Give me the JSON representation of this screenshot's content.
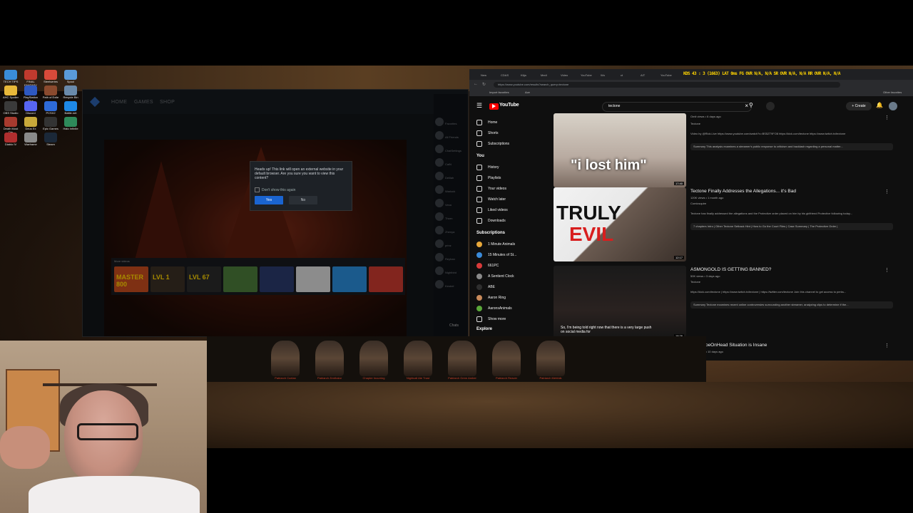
{
  "desktop": {
    "icons": [
      {
        "label": "TECH TIPS",
        "color": "#3a8cd8"
      },
      {
        "label": "FINAL FANTASY XI...",
        "color": "#c03a2e"
      },
      {
        "label": "Steelseries",
        "color": "#d84a3a"
      },
      {
        "label": "Spool",
        "color": "#5a9ad8"
      },
      {
        "label": "AHC Spoiler",
        "color": "#e8b83a"
      },
      {
        "label": "PlayStation Plus",
        "color": "#2e58c0"
      },
      {
        "label": "Path of Exile",
        "color": "#8a4a2e"
      },
      {
        "label": "Recycle Bin",
        "color": "#6a8aaa"
      },
      {
        "label": "OBS Studio",
        "color": "#3a3a3a"
      },
      {
        "label": "Discord",
        "color": "#5865f2"
      },
      {
        "label": "PCSX2",
        "color": "#2e6ad8"
      },
      {
        "label": "Battle.net",
        "color": "#1e88e5"
      },
      {
        "label": "Death Must Die",
        "color": "#a83a2e"
      },
      {
        "label": "Deus Ex",
        "color": "#c8a83a"
      },
      {
        "label": "Epic Games",
        "color": "#333333"
      },
      {
        "label": "Halo Infinite",
        "color": "#2e8a5a"
      },
      {
        "label": "Diablo IV",
        "color": "#b02e2e"
      },
      {
        "label": "Warframe",
        "color": "#8a8a8a"
      },
      {
        "label": "Steam",
        "color": "#1b2838"
      }
    ]
  },
  "launcher": {
    "nav": [
      "HOME",
      "GAMES",
      "SHOP"
    ],
    "dialog": {
      "message": "Heads up! This link will open an external website in your default browser. Are you sure you want to view this content?",
      "checkbox": "Don't show this again",
      "yes": "Yes",
      "no": "No"
    },
    "more_videos_label": "More videos",
    "thumbs": [
      {
        "text": "MASTER 800",
        "color": "#c24a1e"
      },
      {
        "text": "LVL 1",
        "color": "#3a2e24"
      },
      {
        "text": "LVL 67",
        "color": "#2a2a2a"
      },
      {
        "text": "",
        "color": "#4a7a3a"
      },
      {
        "text": "",
        "color": "#2a3a6a"
      },
      {
        "text": "",
        "color": "#d8d8d8"
      },
      {
        "text": "",
        "color": "#2a8ad8"
      },
      {
        "text": "",
        "color": "#c83a2e"
      }
    ],
    "friends": [
      "Favorites",
      "All Friends",
      "ChatSettings",
      "CaiN",
      "Delilah",
      "Warlock",
      "Vexa",
      "Thorn",
      "Zhenya",
      "prinz",
      "Reyhan",
      "Nightbird",
      "Kestrel"
    ],
    "chats_label": "Chats"
  },
  "browser": {
    "tabs": [
      "New",
      "CDAS",
      "Kitja",
      "Medi",
      "Video",
      "YouTube",
      "Wo",
      "ct",
      "AIT",
      "YouTube"
    ],
    "overlay_stats": "KDS 43 : 3 (1663)  LAT 0ms  FG OVR N/A, N/A  SR OVR N/A, N/A  RR OVR N/A, N/A",
    "url": "https://www.youtube.com/results?search_query=tectone",
    "bookmarks": [
      "Import favorites",
      "Ace"
    ],
    "other_bookmarks": "Other favorites",
    "youtube": {
      "logo": "YouTube",
      "search_value": "tectone",
      "create_label": "Create",
      "sidebar": {
        "main": [
          "Home",
          "Shorts",
          "Subscriptions"
        ],
        "you_label": "You",
        "you_items": [
          "History",
          "Playlists",
          "Your videos",
          "Watch later",
          "Liked videos",
          "Downloads"
        ],
        "subscriptions_label": "Subscriptions",
        "subscriptions": [
          {
            "name": "1 Minute Animals",
            "color": "#e8a83a"
          },
          {
            "name": "15 Minutes of St...",
            "color": "#3a8ad8"
          },
          {
            "name": "661PC",
            "color": "#d83a3a"
          },
          {
            "name": "A Sentient Clock",
            "color": "#8a8a8a"
          },
          {
            "name": "ABE",
            "color": "#2e2e2e"
          },
          {
            "name": "Aaron Ring",
            "color": "#c88a5a"
          },
          {
            "name": "AaronsAnimals",
            "color": "#5aa83a"
          }
        ],
        "show_more": "Show more",
        "explore": "Explore"
      },
      "results": [
        {
          "thumb_caption": "\"i lost him\"",
          "duration": "17:40",
          "title": "",
          "meta": "Omit views • 6 days ago",
          "channel": "Tectone",
          "desc": "Video by @Rick.Live https://www.youtube.com/watch?v=BS5ZT9FO8 https://kick.com/tectone https://www.twitch.tv/tectone",
          "summary": "Summary  This analysis examines a streamer's public response to criticism and backlash regarding a personal matter..."
        },
        {
          "thumb_caption_1": "TRULY",
          "thumb_caption_2": "EVIL",
          "duration": "12:17",
          "title": "Tectone Finally Addresses the Allegations... it's Bad",
          "meta": "120K views • 1 month ago",
          "channel": "Comicsquire",
          "desc": "Tectone has finally addressed the allegations and the Protective order placed on him by his girlfriend Protective following today...",
          "summary": "7 chapters  Intro | Other Tectone Setback Hint | How to Go the Court Files | Case Summary | The Protective Order |"
        },
        {
          "thumb_caption": "So, I'm being told right now that there is a very large push on social media for",
          "duration": "16:26",
          "title": "ASMONGOLD IS GETTING BANNED?",
          "meta": "50K views • 3 days ago",
          "channel": "Tectone",
          "desc": "https://kick.com/tectone | https://www.twitch.tv/tectone | https://twitter.com/tectone Join this channel to get access to perks...",
          "summary": "Summary  Tectone examines recent online controversies surrounding another streamer, analyzing clips to determine if the..."
        },
        {
          "title": "The ShoeOnHead Situation is Insane",
          "meta": "370K views • 10 days ago"
        }
      ],
      "status_url": "https://www.youtube.com/watch?v=4yZ_Z0w_ukABpp=ygUHdGVjdG9uZQ%3D%3D"
    }
  },
  "game_strip": {
    "characters": [
      "Patriarch Cuelan",
      "Patriarch Zenthalor",
      "Chapter Incurring",
      "Nightcall Ate Trust",
      "Patriarch Grem Amber",
      "Patriarch Reaver",
      "Patriarch Mehfolk"
    ]
  },
  "colors": {
    "yt_red": "#ff0000",
    "accent_blue": "#1a64d0",
    "overlay_yellow": "#ffd400"
  }
}
